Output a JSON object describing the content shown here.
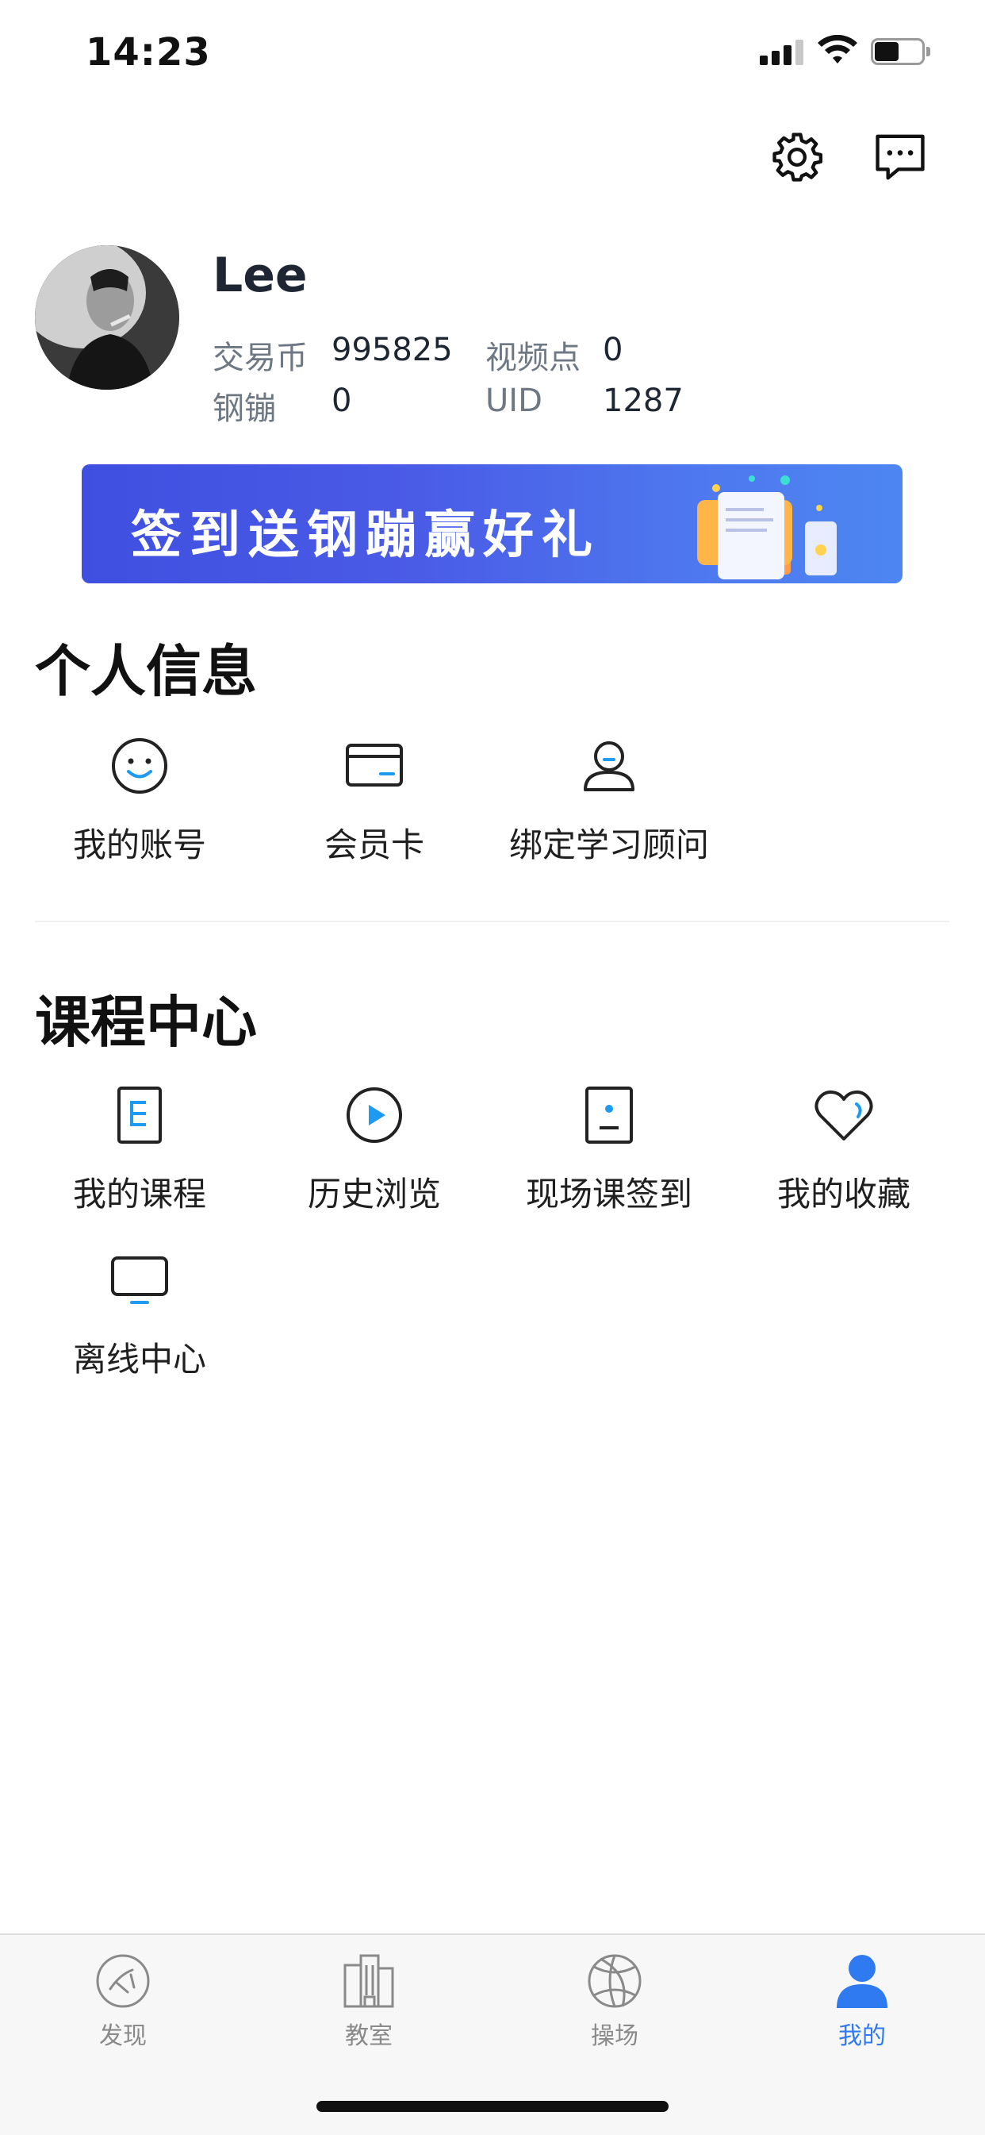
{
  "status_bar": {
    "time": "14:23"
  },
  "profile": {
    "name": "Lee",
    "stats": [
      {
        "label": "交易币",
        "value": "995825"
      },
      {
        "label": "视频点",
        "value": "0"
      },
      {
        "label": "钢镚",
        "value": "0"
      },
      {
        "label": "UID",
        "value": "1287"
      }
    ]
  },
  "banner": {
    "text": "签到送钢蹦赢好礼"
  },
  "personal_info": {
    "title": "个人信息",
    "items": [
      {
        "label": "我的账号",
        "icon": "smile-icon"
      },
      {
        "label": "会员卡",
        "icon": "card-icon"
      },
      {
        "label": "绑定学习顾问",
        "icon": "person-icon"
      }
    ]
  },
  "course_center": {
    "title": "课程中心",
    "items": [
      {
        "label": "我的课程",
        "icon": "document-icon"
      },
      {
        "label": "历史浏览",
        "icon": "play-circle-icon"
      },
      {
        "label": "现场课签到",
        "icon": "id-badge-icon"
      },
      {
        "label": "我的收藏",
        "icon": "heart-icon"
      },
      {
        "label": "离线中心",
        "icon": "monitor-icon"
      }
    ]
  },
  "tabbar": {
    "active_color": "#2f7af0",
    "tabs": [
      {
        "label": "发现",
        "icon": "discover-icon"
      },
      {
        "label": "教室",
        "icon": "building-icon"
      },
      {
        "label": "操场",
        "icon": "basketball-icon"
      },
      {
        "label": "我的",
        "icon": "user-icon"
      }
    ]
  }
}
